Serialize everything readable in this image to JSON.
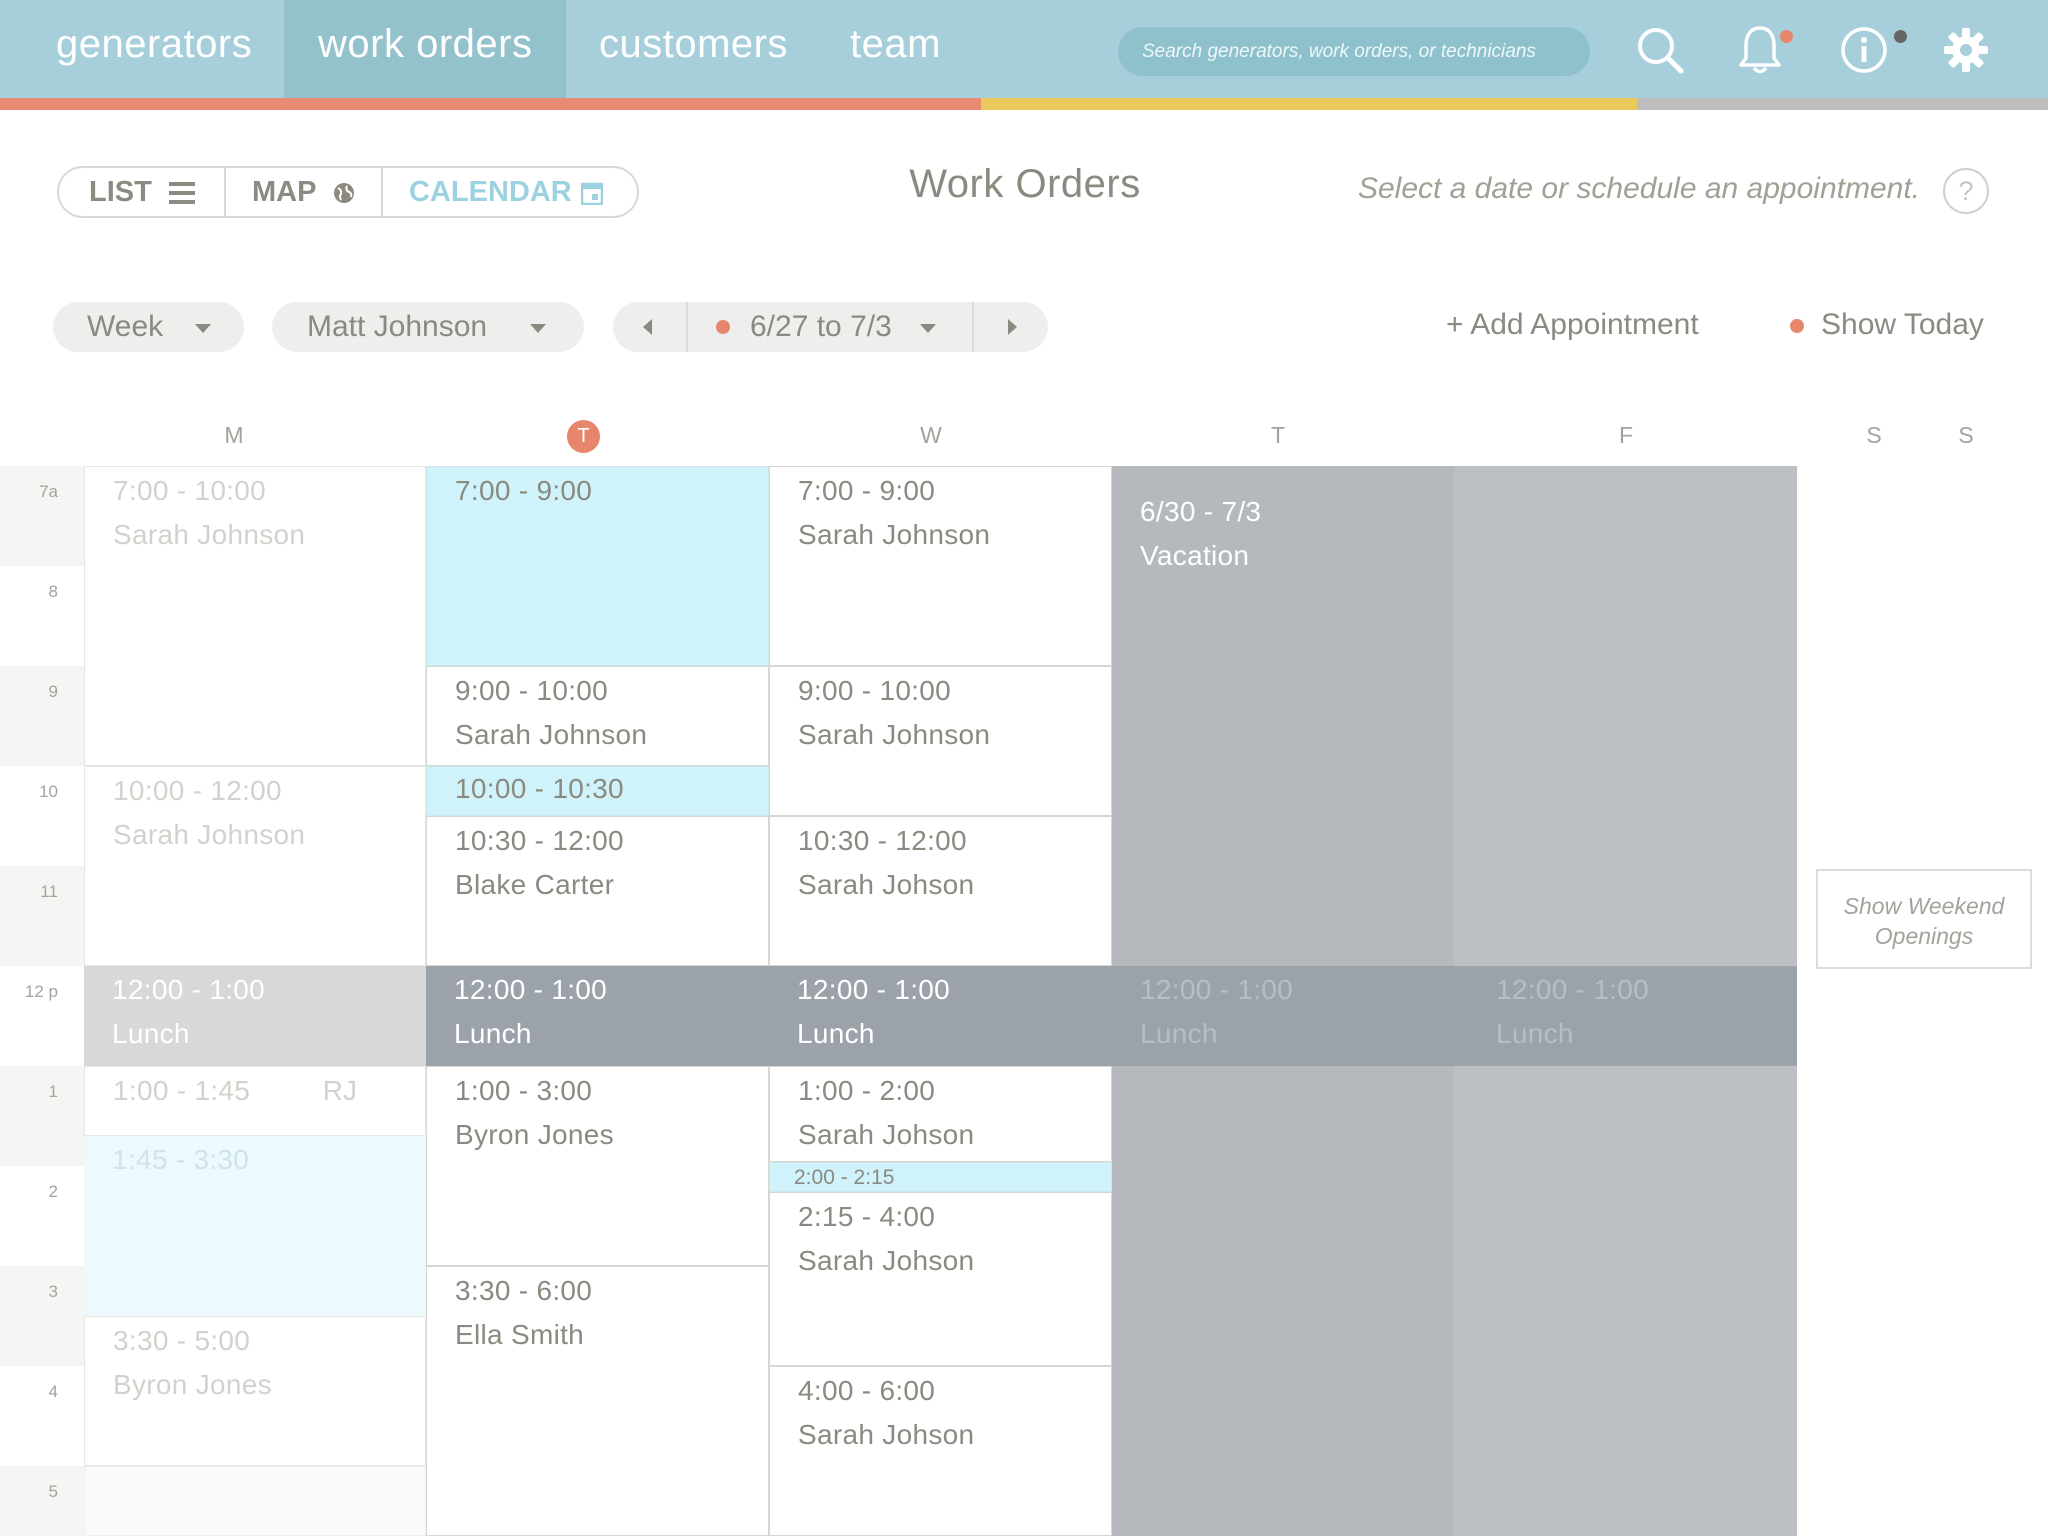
{
  "nav": {
    "items": [
      "generators",
      "work orders",
      "customers",
      "team"
    ],
    "active_index": 1,
    "search_placeholder": "Search generators, work orders, or technicians",
    "icons": [
      "search-icon",
      "bell-icon",
      "info-icon",
      "gear-icon"
    ],
    "notification_dot_color": "#e6866c",
    "info_dot_color": "#666666",
    "bar_color": "#a6cfdb",
    "stripe_colors": [
      "#e98b72",
      "#e9c95c",
      "#bdbdbd"
    ]
  },
  "toolbar": {
    "views": [
      "LIST",
      "MAP",
      "CALENDAR"
    ],
    "selected_view": "CALENDAR",
    "title": "Work Orders",
    "hint": "Select a date or schedule an appointment.",
    "help": "?"
  },
  "filters": {
    "range": "Week",
    "technician": "Matt Johnson",
    "date_range": "6/27 to 7/3",
    "add_appointment": "+ Add Appointment",
    "show_today": "Show Today"
  },
  "calendar": {
    "days": [
      "M",
      "T",
      "W",
      "T",
      "F",
      "S",
      "S"
    ],
    "today": "T",
    "hours": [
      "7a",
      "8",
      "9",
      "10",
      "11",
      "12 p",
      "1",
      "2",
      "3",
      "4",
      "5"
    ],
    "monday": [
      {
        "time": "7:00 - 10:00",
        "name": "Sarah Johnson"
      },
      {
        "time": "10:00 - 12:00",
        "name": "Sarah Johnson"
      },
      {
        "time": "12:00 - 1:00",
        "name": "Lunch"
      },
      {
        "time": "1:00 - 1:45",
        "tag": "RJ"
      },
      {
        "time": "1:45 - 3:30"
      },
      {
        "time": "3:30 - 5:00",
        "name": "Byron Jones"
      }
    ],
    "tuesday": [
      {
        "time": "7:00 - 9:00"
      },
      {
        "time": "9:00 - 10:00",
        "name": "Sarah Johnson"
      },
      {
        "time": "10:00 - 10:30"
      },
      {
        "time": "10:30 - 12:00",
        "name": "Blake Carter"
      },
      {
        "time": "12:00 - 1:00",
        "name": "Lunch"
      },
      {
        "time": "1:00 - 3:00",
        "name": "Byron Jones"
      },
      {
        "time": "3:30 - 6:00",
        "name": "Ella Smith"
      }
    ],
    "wednesday": [
      {
        "time": "7:00 - 9:00",
        "name": "Sarah Johnson"
      },
      {
        "time": "9:00 - 10:00",
        "name": "Sarah Johnson"
      },
      {
        "time": "10:30 - 12:00",
        "name": "Sarah Johson"
      },
      {
        "time": "12:00 - 1:00",
        "name": "Lunch"
      },
      {
        "time": "1:00 - 2:00",
        "name": "Sarah Johson"
      },
      {
        "time": "2:00 - 2:15"
      },
      {
        "time": "2:15 - 4:00",
        "name": "Sarah Johson"
      },
      {
        "time": "4:00 - 6:00",
        "name": "Sarah Johson"
      }
    ],
    "vacation": {
      "time": "6/30 - 7/3",
      "name": "Vacation"
    },
    "thursday_lunch": {
      "time": "12:00 - 1:00",
      "name": "Lunch"
    },
    "friday_lunch": {
      "time": "12:00 - 1:00",
      "name": "Lunch"
    },
    "weekend_button": "Show Weekend Openings"
  }
}
